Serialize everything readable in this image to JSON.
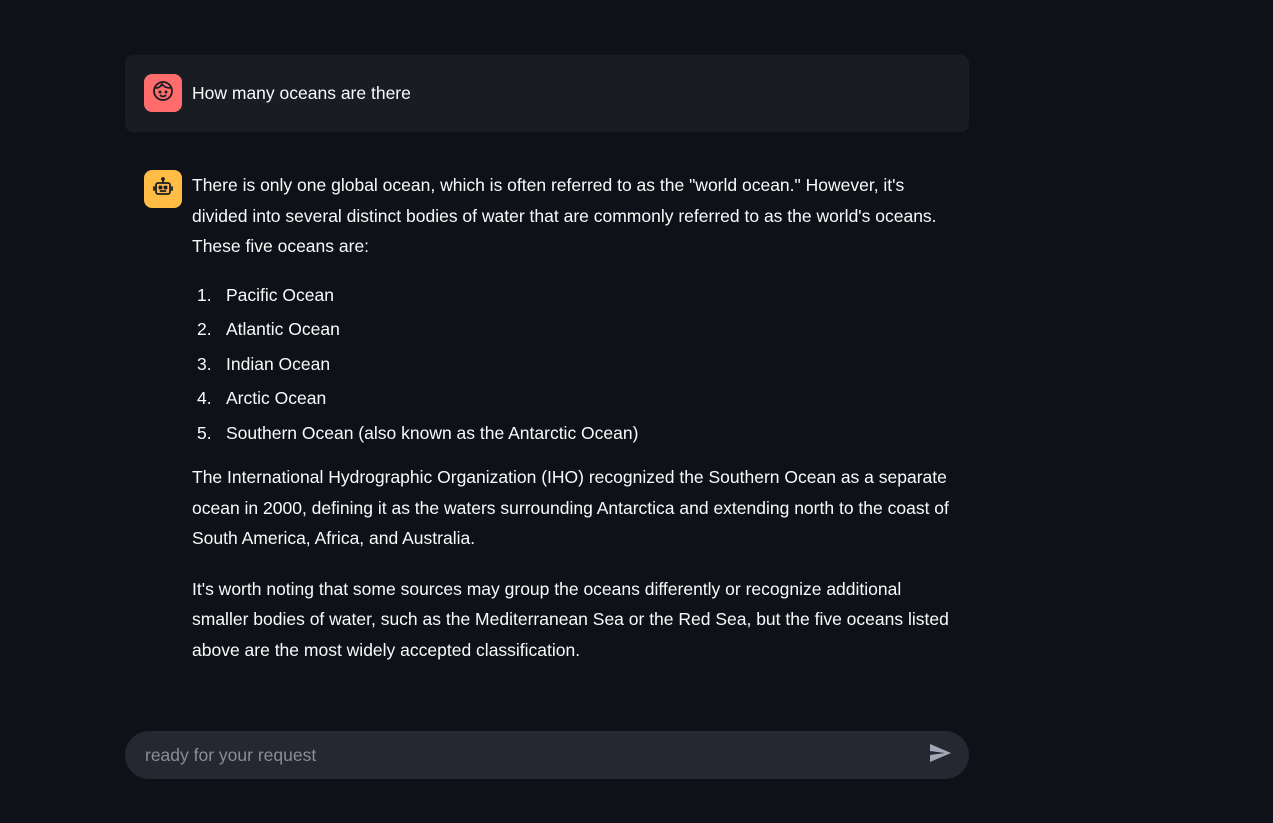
{
  "chat": {
    "user_message": {
      "avatar_icon": "user-face-icon",
      "avatar_color": "#ff6c6c",
      "text": "How many oceans are there"
    },
    "assistant_message": {
      "avatar_icon": "robot-icon",
      "avatar_color": "#ffbd45",
      "intro": "There is only one global ocean, which is often referred to as the \"world ocean.\" However, it's divided into several distinct bodies of water that are commonly referred to as the world's oceans. These five oceans are:",
      "oceans": [
        {
          "num": "1.",
          "name": "Pacific Ocean"
        },
        {
          "num": "2.",
          "name": "Atlantic Ocean"
        },
        {
          "num": "3.",
          "name": "Indian Ocean"
        },
        {
          "num": "4.",
          "name": "Arctic Ocean"
        },
        {
          "num": "5.",
          "name": "Southern Ocean (also known as the Antarctic Ocean)"
        }
      ],
      "paragraph_2": "The International Hydrographic Organization (IHO) recognized the Southern Ocean as a separate ocean in 2000, defining it as the waters surrounding Antarctica and extending north to the coast of South America, Africa, and Australia.",
      "paragraph_3": "It's worth noting that some sources may group the oceans differently or recognize additional smaller bodies of water, such as the Mediterranean Sea or the Red Sea, but the five oceans listed above are the most widely accepted classification."
    }
  },
  "input": {
    "placeholder": "ready for your request",
    "value": "",
    "send_icon": "send-icon"
  },
  "colors": {
    "background": "#0e1117",
    "user_bubble": "#1a1c24",
    "input_bg": "#262730",
    "text": "#fafafa",
    "placeholder": "#8b8d95"
  }
}
